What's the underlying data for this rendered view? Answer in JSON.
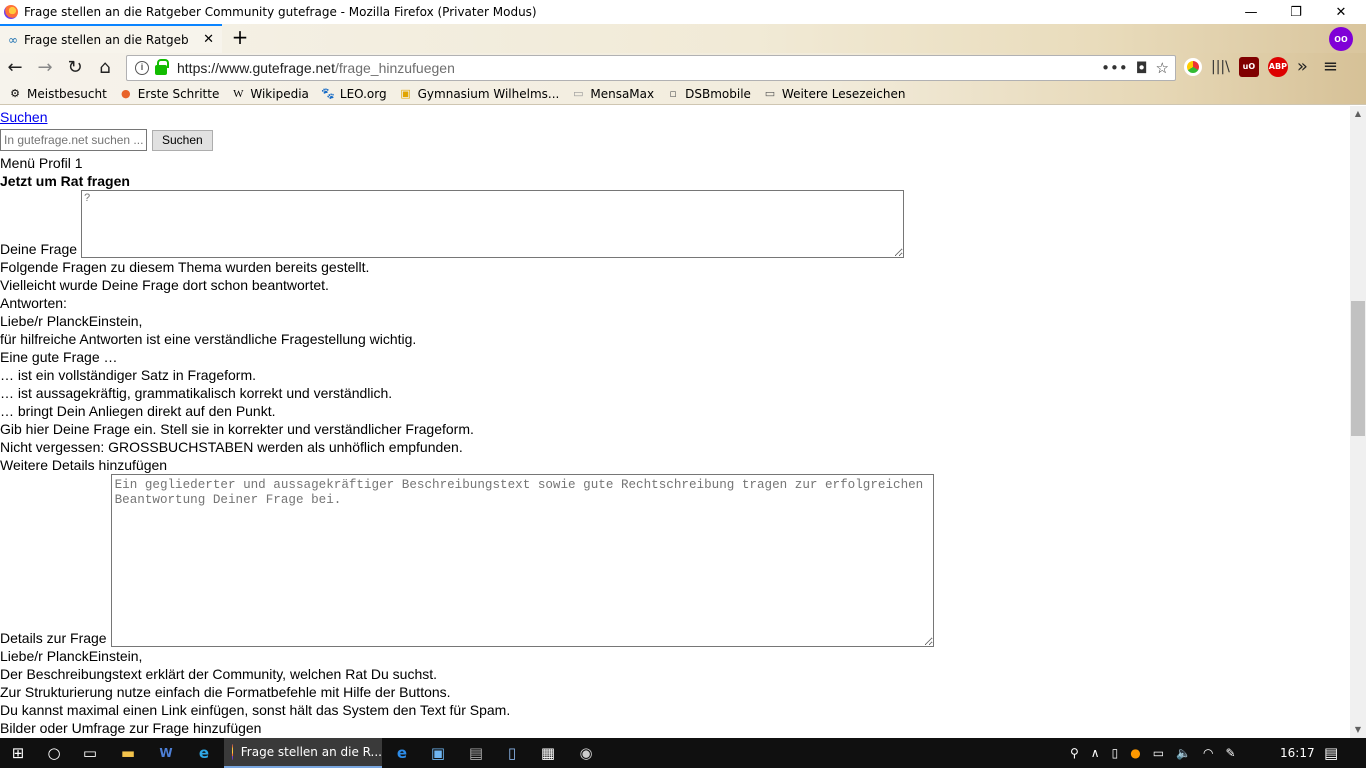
{
  "window": {
    "title": "Frage stellen an die Ratgeber Community gutefrage - Mozilla Firefox (Privater Modus)",
    "minimize": "—",
    "maximize": "❐",
    "close": "✕"
  },
  "tab": {
    "icon": "∞",
    "title": "Frage stellen an die Ratgeber Co",
    "close": "✕"
  },
  "toolbar": {
    "back": "←",
    "forward": "→",
    "reload": "↻",
    "home": "⌂",
    "new_tab": "+",
    "url_host": "https://www.gutefrage.net",
    "url_path": "/frage_hinzufuegen",
    "page_actions": "•••",
    "pocket": "◘",
    "bookmark_star": "☆",
    "library": "|||\\",
    "menu": "≡",
    "overflow": "»"
  },
  "bookmarks": [
    {
      "icon": "⚙",
      "label": "Meistbesucht"
    },
    {
      "icon": "●",
      "label": "Erste Schritte"
    },
    {
      "icon": "W",
      "label": "Wikipedia"
    },
    {
      "icon": "🐾",
      "label": "LEO.org"
    },
    {
      "icon": "▣",
      "label": "Gymnasium Wilhelms..."
    },
    {
      "icon": "▭",
      "label": "MensaMax"
    },
    {
      "icon": "▫",
      "label": "DSBmobile"
    },
    {
      "icon": "▭",
      "label": "Weitere Lesezeichen"
    }
  ],
  "extensions": {
    "ublock": "uO",
    "abp": "ABP",
    "private": "oo"
  },
  "page": {
    "search_link": "Suchen",
    "search_placeholder": "In gutefrage.net suchen ...",
    "search_button": "Suchen",
    "menu_profile": "Menü Profil 1",
    "heading": "Jetzt um Rat fragen",
    "question_label": "Deine Frage",
    "question_placeholder": "?",
    "lines_after_question": [
      "Folgende Fragen zu diesem Thema wurden bereits gestellt.",
      "Vielleicht wurde Deine Frage dort schon beantwortet.",
      "Antworten:",
      "Liebe/r PlanckEinstein,",
      "für hilfreiche Antworten ist eine verständliche Fragestellung wichtig.",
      "Eine gute Frage …",
      "… ist ein vollständiger Satz in Frageform.",
      "… ist aussagekräftig, grammatikalisch korrekt und verständlich.",
      "… bringt Dein Anliegen direkt auf den Punkt.",
      "Gib hier Deine Frage ein. Stell sie in korrekter und verständlicher Frageform.",
      "Nicht vergessen: GROSSBUCHSTABEN werden als unhöflich empfunden.",
      "Weitere Details hinzufügen"
    ],
    "details_label": "Details zur Frage",
    "details_placeholder": "Ein gegliederter und aussagekräftiger Beschreibungstext sowie gute Rechtschreibung tragen zur erfolgreichen Beantwortung Deiner Frage bei.",
    "lines_after_details": [
      "Liebe/r PlanckEinstein,",
      "Der Beschreibungstext erklärt der Community, welchen Rat Du suchst.",
      "Zur Strukturierung nutze einfach die Formatbefehle mit Hilfe der Buttons.",
      "Du kannst maximal einen Link einfügen, sonst hält das System den Text für Spam.",
      "Bilder oder Umfrage zur Frage hinzufügen"
    ]
  },
  "taskbar": {
    "active_window": "Frage stellen an die R...",
    "clock": "16:17"
  }
}
